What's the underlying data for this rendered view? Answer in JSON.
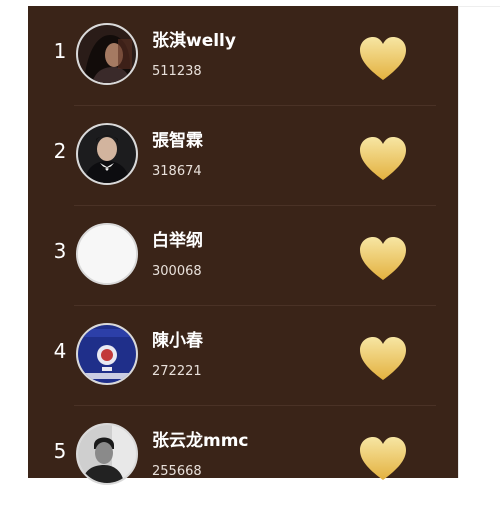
{
  "colors": {
    "panel_bg": "#3a2418",
    "heart_top": "#f7e6a3",
    "heart_bottom": "#e3b13f",
    "text": "#ffffff"
  },
  "ranking": {
    "items": [
      {
        "rank": "1",
        "name": "张淇welly",
        "score": "511238",
        "avatar": "photo-woman-dark-hair",
        "heart_icon": "heart-icon"
      },
      {
        "rank": "2",
        "name": "張智霖",
        "score": "318674",
        "avatar": "photo-man-bowtie",
        "heart_icon": "heart-icon"
      },
      {
        "rank": "3",
        "name": "白举纲",
        "score": "300068",
        "avatar": "blank-white",
        "heart_icon": "heart-icon"
      },
      {
        "rank": "4",
        "name": "陳小春",
        "score": "272221",
        "avatar": "passport-emblem",
        "heart_icon": "heart-icon"
      },
      {
        "rank": "5",
        "name": "张云龙mmc",
        "score": "255668",
        "avatar": "photo-man-bw",
        "heart_icon": "heart-icon"
      }
    ]
  }
}
